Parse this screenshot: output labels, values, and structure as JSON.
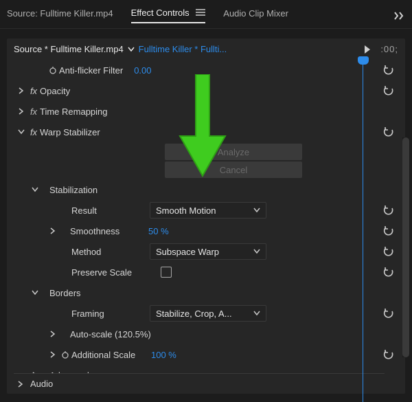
{
  "tabs": {
    "source": "Source: Fulltime Killer.mp4",
    "effects": "Effect Controls",
    "audio_mixer": "Audio Clip Mixer"
  },
  "panel_head": {
    "source": "Source * Fulltime Killer.mp4",
    "clip": "Fulltime Killer * Fullti...",
    "time": ":00;"
  },
  "effects": {
    "anti_flicker": {
      "label": "Anti-flicker Filter",
      "value": "0.00"
    },
    "opacity": {
      "label": "Opacity"
    },
    "time_remapping": {
      "label": "Time Remapping"
    },
    "warp": {
      "label": "Warp Stabilizer",
      "analyze": "Analyze",
      "cancel": "Cancel",
      "stabilization": {
        "header": "Stabilization",
        "result": {
          "label": "Result",
          "value": "Smooth Motion"
        },
        "smoothness": {
          "label": "Smoothness",
          "value": "50 %"
        },
        "method": {
          "label": "Method",
          "value": "Subspace Warp"
        },
        "preserve_scale": {
          "label": "Preserve Scale"
        }
      },
      "borders": {
        "header": "Borders",
        "framing": {
          "label": "Framing",
          "value": "Stabilize, Crop, A..."
        },
        "auto_scale": {
          "label": "Auto-scale (120.5%)"
        },
        "additional_scale": {
          "label": "Additional Scale",
          "value": "100 %"
        }
      },
      "advanced": "Advanced"
    }
  },
  "footer": {
    "audio": "Audio"
  },
  "icons": {
    "chevron_right": "›",
    "chevron_down": "⌄"
  }
}
